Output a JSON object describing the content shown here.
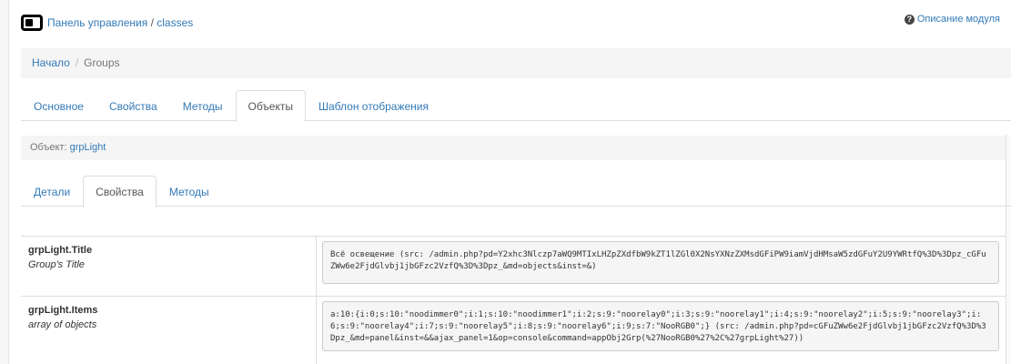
{
  "header": {
    "breadcrumb_link": "Панель управления",
    "breadcrumb_sep": " / ",
    "breadcrumb_current": "classes",
    "module_help": "Описание модуля"
  },
  "breadcrumb": {
    "home": "Начало",
    "sep": "/",
    "current": "Groups"
  },
  "main_tabs": [
    {
      "label": "Основное",
      "active": false
    },
    {
      "label": "Свойства",
      "active": false
    },
    {
      "label": "Методы",
      "active": false
    },
    {
      "label": "Объекты",
      "active": true
    },
    {
      "label": "Шаблон отображения",
      "active": false
    }
  ],
  "object_bar": {
    "label": "Объект:",
    "name": "grpLight"
  },
  "sub_tabs": [
    {
      "label": "Детали",
      "active": false
    },
    {
      "label": "Свойства",
      "active": true
    },
    {
      "label": "Методы",
      "active": false
    }
  ],
  "properties": [
    {
      "name": "grpLight.Title",
      "description": "Group's Title",
      "value": "Всё освещение (src: /admin.php?pd=Y2xhc3Nlczp7aWQ9MTIxLHZpZXdfbW9kZT1lZGl0X2NsYXNzZXMsdGFiPW9iamVjdHMsaW5zdGFuY2U9YWRtfQ%3D%3Dpz_cGFuZWw6e2FjdGlvbj1jbGFzc2VzfQ%3D%3Dpz_&md=objects&inst=&)"
    },
    {
      "name": "grpLight.Items",
      "description": "array of objects",
      "value": "a:10:{i:0;s:10:\"noodimmer0\";i:1;s:10:\"noodimmer1\";i:2;s:9:\"noorelay0\";i:3;s:9:\"noorelay1\";i:4;s:9:\"noorelay2\";i:5;s:9:\"noorelay3\";i:6;s:9:\"noorelay4\";i:7;s:9:\"noorelay5\";i:8;s:9:\"noorelay6\";i:9;s:7:\"NooRGB0\";} (src: /admin.php?pd=cGFuZWw6e2FjdGlvbj1jbGFzc2VzfQ%3D%3Dpz_&md=panel&inst=&&ajax_panel=1&op=console&command=appObj2Grp(%27NooRGB0%27%2C%27grpLight%27))"
    }
  ]
}
